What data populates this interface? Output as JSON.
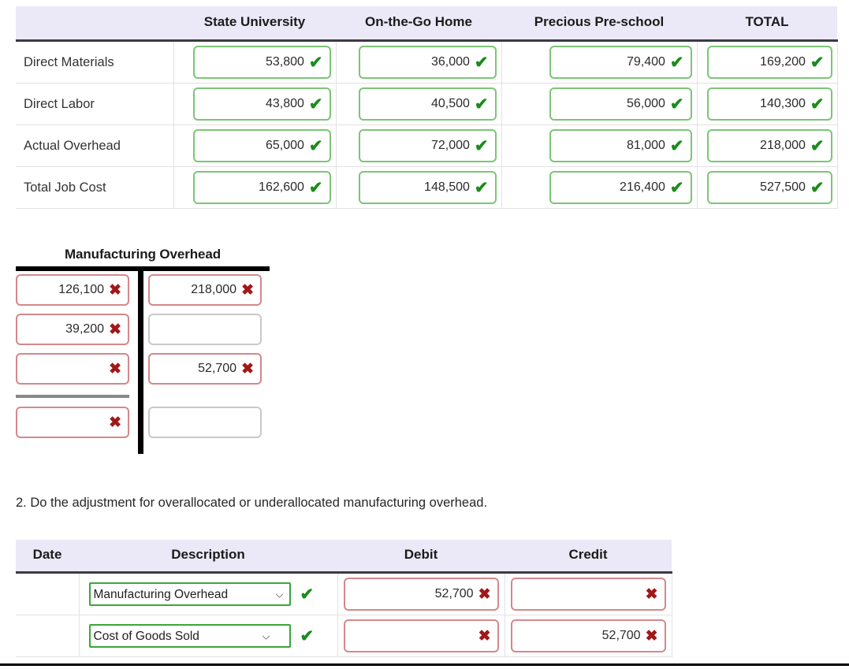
{
  "job_cost_table": {
    "columns": [
      "",
      "State University",
      "On-the-Go Home",
      "Precious Pre-school",
      "TOTAL"
    ],
    "rows": [
      {
        "label": "Direct Materials",
        "cells": [
          {
            "value": "53,800",
            "mark": "check"
          },
          {
            "value": "36,000",
            "mark": "check"
          },
          {
            "value": "79,400",
            "mark": "check"
          },
          {
            "value": "169,200",
            "mark": "check"
          }
        ]
      },
      {
        "label": "Direct Labor",
        "cells": [
          {
            "value": "43,800",
            "mark": "check"
          },
          {
            "value": "40,500",
            "mark": "check"
          },
          {
            "value": "56,000",
            "mark": "check"
          },
          {
            "value": "140,300",
            "mark": "check"
          }
        ]
      },
      {
        "label": "Actual Overhead",
        "cells": [
          {
            "value": "65,000",
            "mark": "check"
          },
          {
            "value": "72,000",
            "mark": "check"
          },
          {
            "value": "81,000",
            "mark": "check"
          },
          {
            "value": "218,000",
            "mark": "check"
          }
        ]
      },
      {
        "label": "Total Job Cost",
        "cells": [
          {
            "value": "162,600",
            "mark": "check"
          },
          {
            "value": "148,500",
            "mark": "check"
          },
          {
            "value": "216,400",
            "mark": "check"
          },
          {
            "value": "527,500",
            "mark": "check"
          }
        ]
      }
    ]
  },
  "t_account": {
    "title": "Manufacturing Overhead",
    "debit_side": [
      {
        "value": "126,100",
        "mark": "cross"
      },
      {
        "value": "39,200",
        "mark": "cross"
      },
      {
        "value": "",
        "mark": "cross"
      },
      {
        "value": "",
        "mark": "cross"
      }
    ],
    "credit_side": [
      {
        "value": "218,000",
        "mark": "cross"
      },
      {
        "value": "",
        "mark": "none"
      },
      {
        "value": "52,700",
        "mark": "cross"
      },
      {
        "value": "",
        "mark": "none"
      }
    ]
  },
  "question_2": {
    "text": "2. Do the adjustment for overallocated or underallocated manufacturing overhead."
  },
  "journal_table": {
    "columns": [
      "Date",
      "Description",
      "Debit",
      "Credit"
    ],
    "rows": [
      {
        "date": "",
        "account": "Manufacturing Overhead",
        "account_mark": "check",
        "debit": {
          "value": "52,700",
          "mark": "cross"
        },
        "credit": {
          "value": "",
          "mark": "cross"
        }
      },
      {
        "date": "",
        "account": "Cost of Goods Sold",
        "account_mark": "check",
        "debit": {
          "value": "",
          "mark": "cross"
        },
        "credit": {
          "value": "52,700",
          "mark": "cross"
        }
      }
    ]
  },
  "marks": {
    "check_glyph": "✔",
    "cross_glyph": "✖",
    "chevron_glyph": "⌵"
  },
  "colors": {
    "header_bg": "#ebe9f7",
    "correct_green": "#1a8c1a",
    "incorrect_red": "#a01818",
    "ok_border": "#7cc576",
    "bad_border": "#d4888c",
    "neutral_border": "#c9c9c9"
  }
}
